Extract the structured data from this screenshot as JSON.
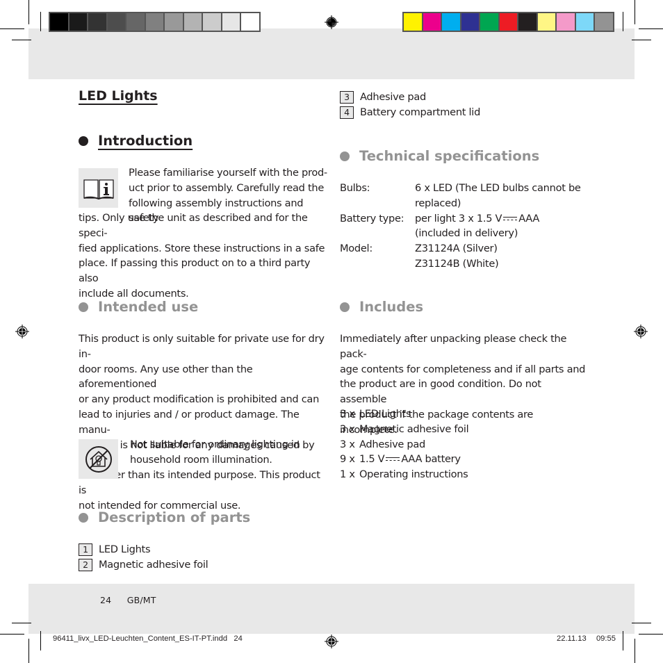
{
  "print_marks": {
    "gray_swatches": [
      "#000000",
      "#1a1a1a",
      "#333333",
      "#4d4d4d",
      "#666666",
      "#808080",
      "#999999",
      "#b3b3b3",
      "#cccccc",
      "#e6e6e6",
      "#ffffff"
    ],
    "color_swatches": [
      "#fff200",
      "#ec008c",
      "#00aeef",
      "#2e3192",
      "#00a651",
      "#ed1c24",
      "#231f20",
      "#fff685",
      "#f49ac9",
      "#7dd8f8",
      "#939393"
    ]
  },
  "colors": {
    "band_gray": "#e8e8e8",
    "heading_gray": "#939393",
    "text": "#231f20"
  },
  "document": {
    "title": "LED Lights",
    "sections": {
      "introduction": {
        "heading": "Introduction",
        "icon": "read-instructions-icon",
        "lines": [
          "Please familiarise yourself with the prod-",
          "uct prior to assembly. Carefully read the",
          "following assembly instructions and safety",
          "tips. Only use the unit as described and for the speci-",
          "fied applications. Store these instructions in a safe",
          "place. If passing this product on to a third party also",
          "include all documents."
        ]
      },
      "intended_use": {
        "heading": "Intended use",
        "lines": [
          "This product is only suitable for private use for dry in-",
          "door rooms. Any use other than the aforementioned",
          "or any product modification is prohibited and can",
          "lead to injuries and / or product damage. The manu-",
          "facturer is not liable for any damages caused by any",
          "use other than its intended purpose. This product is",
          "not intended for commercial use."
        ],
        "notice_icon": "not-for-household-lighting-icon",
        "notice_lines": [
          "Not suitable for ordinary lighting in",
          "household room illumination."
        ]
      },
      "description_of_parts": {
        "heading": "Description of parts",
        "parts": [
          {
            "num": "1",
            "label": "LED Lights"
          },
          {
            "num": "2",
            "label": "Magnetic adhesive foil"
          },
          {
            "num": "3",
            "label": "Adhesive pad"
          },
          {
            "num": "4",
            "label": "Battery compartment lid"
          }
        ]
      },
      "technical_specifications": {
        "heading": "Technical specifications",
        "rows": [
          {
            "label": "Bulbs:",
            "lines": [
              "6 x LED (The LED bulbs cannot be",
              "replaced)"
            ]
          },
          {
            "label": "Battery type:",
            "lines": [
              "per light 3 x 1.5 V",
              "AAA",
              "(included in delivery)"
            ]
          },
          {
            "label": "Model:",
            "lines": [
              "Z31124A (Silver)",
              "Z31124B (White)"
            ]
          }
        ]
      },
      "includes": {
        "heading": "Includes",
        "lines": [
          "Immediately after unpacking please check the pack-",
          "age contents for completeness and if all parts and",
          "the product are in good condition. Do not assemble",
          "the product if the package contents are incomplete."
        ],
        "items": [
          {
            "qty": "3 x",
            "label": "LED Lights"
          },
          {
            "qty": "3 x",
            "label": "Magnetic adhesive foil"
          },
          {
            "qty": "3 x",
            "label": "Adhesive pad"
          },
          {
            "qty": "9 x",
            "label_pre": "1.5 V",
            "label_post": "AAA battery"
          },
          {
            "qty": "1 x",
            "label": "Operating instructions"
          }
        ]
      }
    }
  },
  "footer": {
    "page_number": "24",
    "language": "GB/MT",
    "filename": "96411_livx_LED-Leuchten_Content_ES-IT-PT.indd   24",
    "date": "22.11.13",
    "time": "09:55"
  }
}
